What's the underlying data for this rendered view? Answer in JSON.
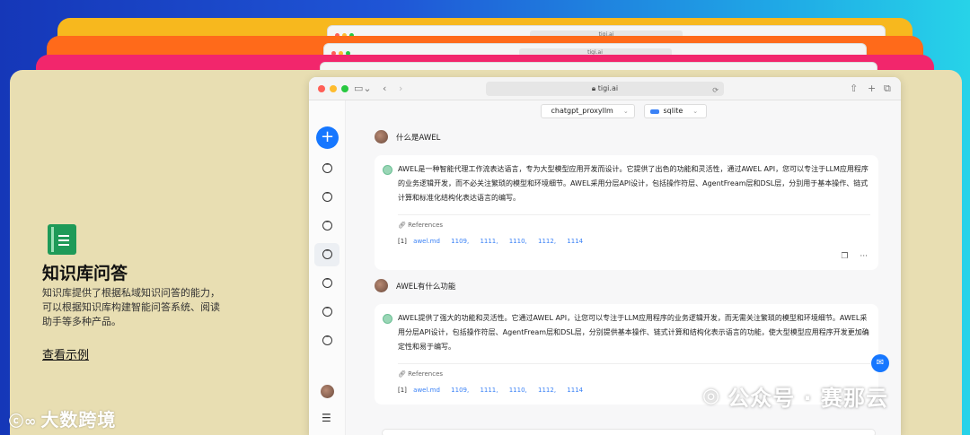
{
  "background_stack": {
    "window_url": "tigi.ai"
  },
  "left_panel": {
    "icon": "book-icon",
    "title": "知识库问答",
    "description": "知识库提供了根据私域知识问答的能力，可以根据知识库构建智能问答系统、阅读助手等多种产品。",
    "link_label": "查看示例"
  },
  "bottom_logo": "大数跨境",
  "browser": {
    "url": "tigi.ai",
    "model_select": "chatgpt_proxyllm",
    "db_select": "sqlite"
  },
  "sidebar": {
    "new_chat_icon": "plus-icon",
    "chat_items": [
      "chat-icon",
      "chat-icon",
      "chat-icon",
      "chat-icon",
      "chat-icon",
      "chat-icon",
      "chat-icon"
    ],
    "menu_icon": "menu-icon",
    "settings_icon": "gear-icon"
  },
  "conversation": [
    {
      "question": "什么是AWEL",
      "answer": "AWEL是一种智能代理工作流表达语言，专为大型模型应用开发而设计。它提供了出色的功能和灵活性，通过AWEL API，您可以专注于LLM应用程序的业务逻辑开发，而不必关注繁琐的模型和环境细节。AWEL采用分层API设计，包括操作符层、AgentFream层和DSL层，分别用于基本操作、链式计算和标准化结构化表达语言的编写。",
      "refs_label": "References",
      "ref_index": "[1]",
      "ref_file": "awel.md",
      "ref_pages": [
        "1109,",
        "1111,",
        "1110,",
        "1112,",
        "1114"
      ]
    },
    {
      "question": "AWEL有什么功能",
      "answer": "AWEL提供了强大的功能和灵活性。它通过AWEL API，让您可以专注于LLM应用程序的业务逻辑开发，而无需关注繁琐的模型和环境细节。AWEL采用分层API设计，包括操作符层、AgentFream层和DSL层，分别提供基本操作、链式计算和结构化表示语言的功能，使大型模型应用程序开发更加确定性和易于编写。",
      "refs_label": "References",
      "ref_index": "[1]",
      "ref_file": "awel.md",
      "ref_pages": [
        "1109,",
        "1111,",
        "1110,",
        "1112,",
        "1114"
      ]
    }
  ],
  "watermark": "公众号 · 赛那云",
  "colors": {
    "accent": "#1677ff",
    "card_bg": "#e8deb2",
    "stack_yellow": "#f7b81e",
    "stack_orange": "#ff6a1a",
    "stack_pink": "#f2266c"
  }
}
